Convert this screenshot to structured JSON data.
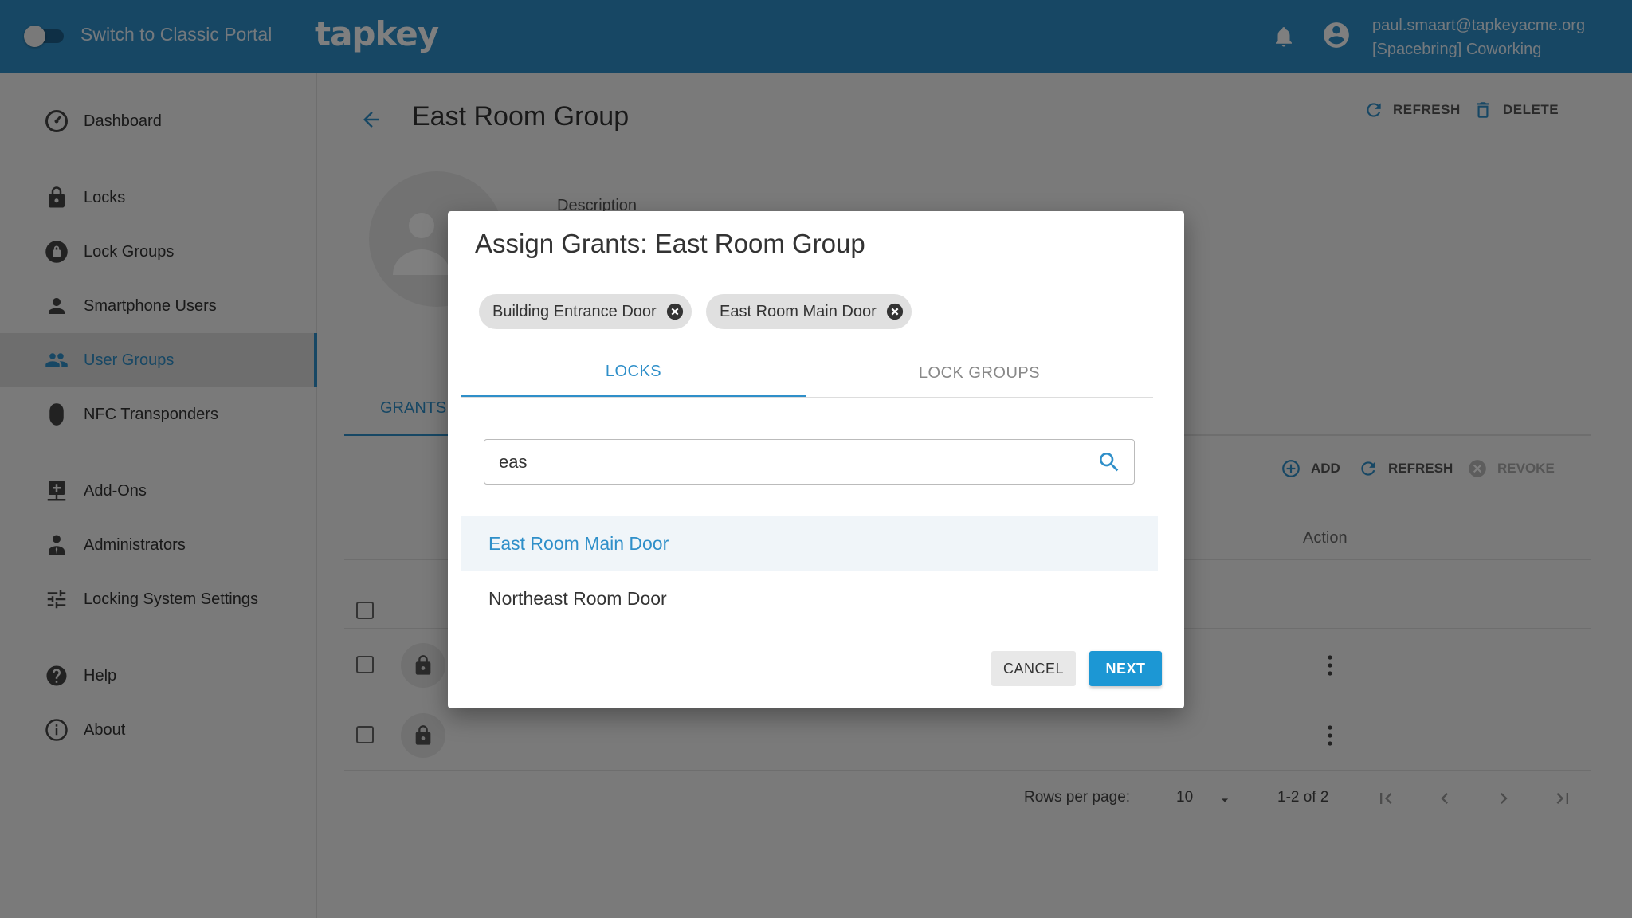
{
  "header": {
    "switch_label": "Switch to Classic Portal",
    "logo": "tapkey",
    "user_email": "paul.smaart@tapkeyacme.org",
    "user_org": "[Spacebring] Coworking"
  },
  "sidebar": {
    "items": [
      {
        "label": "Dashboard",
        "icon": "dashboard-icon"
      },
      {
        "label": "Locks",
        "icon": "lock-icon"
      },
      {
        "label": "Lock Groups",
        "icon": "lock-group-icon"
      },
      {
        "label": "Smartphone Users",
        "icon": "person-icon"
      },
      {
        "label": "User Groups",
        "icon": "group-icon",
        "active": true
      },
      {
        "label": "NFC Transponders",
        "icon": "transponder-icon"
      },
      {
        "label": "Add-Ons",
        "icon": "addon-icon"
      },
      {
        "label": "Administrators",
        "icon": "admin-icon"
      },
      {
        "label": "Locking System Settings",
        "icon": "settings-sliders-icon"
      },
      {
        "label": "Help",
        "icon": "help-icon"
      },
      {
        "label": "About",
        "icon": "info-icon"
      }
    ]
  },
  "main": {
    "title": "East Room Group",
    "refresh_label": "REFRESH",
    "delete_label": "DELETE",
    "description_label": "Description",
    "grants_tab": "GRANTS",
    "table": {
      "add_label": "ADD",
      "refresh_label": "REFRESH",
      "revoke_label": "REVOKE",
      "action_header": "Action"
    },
    "pager": {
      "rows_label": "Rows per page:",
      "rows_value": "10",
      "range": "1-2 of 2"
    }
  },
  "dialog": {
    "title": "Assign Grants: East Room Group",
    "chips": [
      "Building Entrance Door",
      "East Room Main Door"
    ],
    "tabs": {
      "locks": "LOCKS",
      "lock_groups": "LOCK GROUPS"
    },
    "search_value": "eas",
    "results": [
      "East Room Main Door",
      "Northeast Room Door"
    ],
    "cancel_label": "CANCEL",
    "next_label": "NEXT"
  },
  "colors": {
    "primary": "#2f8fc9",
    "next_button": "#1c97d4"
  }
}
